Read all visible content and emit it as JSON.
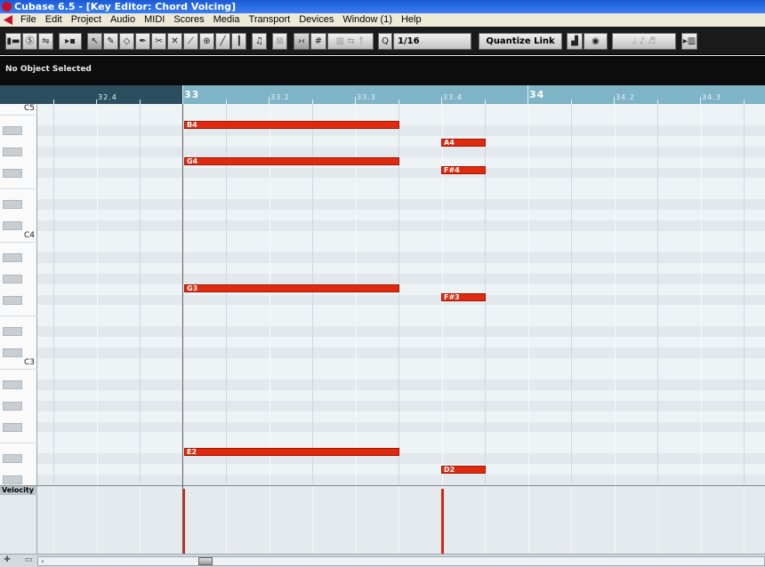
{
  "window": {
    "title": "Cubase 6.5 - [Key Editor: Chord Voicing]"
  },
  "menu": [
    "File",
    "Edit",
    "Project",
    "Audio",
    "MIDI",
    "Scores",
    "Media",
    "Transport",
    "Devices",
    "Window (1)",
    "Help"
  ],
  "toolbar": {
    "quantize_value": "1/16",
    "quantize_link": "Quantize Link",
    "icons": [
      "solo-editor-icon",
      "mute-icon",
      "autoscroll-icon",
      "object-select-icon",
      "draw-icon",
      "erase-icon",
      "split-icon",
      "glue-icon",
      "mute-tool-icon",
      "zoom-icon",
      "line-icon",
      "play-icon",
      "acoustic-feedback-icon",
      "snap-icon",
      "quantize-icon",
      "midi-input-icon"
    ]
  },
  "info_line": "No Object Selected",
  "ruler": {
    "labels": [
      {
        "text": "32.4",
        "major": false
      },
      {
        "text": "33",
        "major": true
      },
      {
        "text": "33.2",
        "major": false
      },
      {
        "text": "33.3",
        "major": false
      },
      {
        "text": "33.4",
        "major": false
      },
      {
        "text": "34",
        "major": true
      },
      {
        "text": "34.2",
        "major": false
      },
      {
        "text": "34.3",
        "major": false
      }
    ]
  },
  "keyboard": {
    "octave_labels": [
      "C5",
      "C4",
      "C3"
    ]
  },
  "notes": [
    {
      "name": "B4",
      "start": "33",
      "length_beats": 2.5
    },
    {
      "name": "A4",
      "start": "33.4",
      "length_beats": 0.5
    },
    {
      "name": "G4",
      "start": "33",
      "length_beats": 2.5
    },
    {
      "name": "F#4",
      "start": "33.4",
      "length_beats": 0.5
    },
    {
      "name": "G3",
      "start": "33",
      "length_beats": 2.5
    },
    {
      "name": "F#3",
      "start": "33.4",
      "length_beats": 0.5
    },
    {
      "name": "E2",
      "start": "33",
      "length_beats": 2.5
    },
    {
      "name": "D2",
      "start": "33.4",
      "length_beats": 0.5
    }
  ],
  "velocity_lane": {
    "label": "Velocity"
  }
}
